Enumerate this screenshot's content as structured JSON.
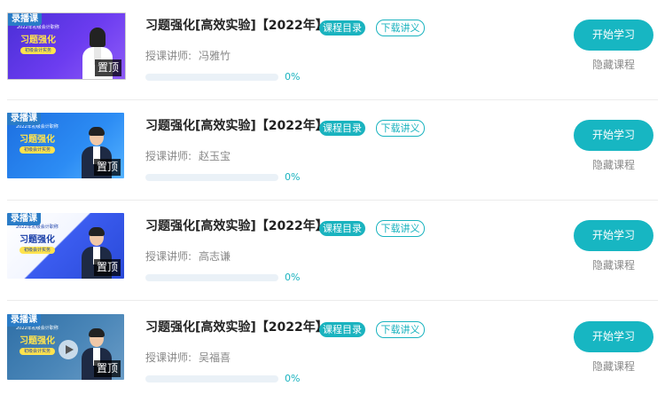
{
  "colors": {
    "accent": "#17b6c2",
    "progress_track": "#eaf1f7",
    "thumb_tag": "#2a7cc7"
  },
  "courses": [
    {
      "title": "习题强化[高效实验]【2022年】",
      "catalog_label": "课程目录",
      "handout_label": "下载讲义",
      "teacher_label": "授课讲师:",
      "teacher_name": "冯雅竹",
      "progress": 0,
      "progress_text": "0%",
      "start_label": "开始学习",
      "hide_label": "隐藏课程",
      "thumb_tag": "录播课",
      "thumb_line1": "2022年初级会计职称",
      "thumb_line2": "习题强化",
      "thumb_line3": "初级会计实务",
      "pin_label": "置顶",
      "thumb_theme": "purple",
      "has_play": false
    },
    {
      "title": "习题强化[高效实验]【2022年】",
      "catalog_label": "课程目录",
      "handout_label": "下载讲义",
      "teacher_label": "授课讲师:",
      "teacher_name": "赵玉宝",
      "progress": 0,
      "progress_text": "0%",
      "start_label": "开始学习",
      "hide_label": "隐藏课程",
      "thumb_tag": "录播课",
      "thumb_line1": "2022年初级会计职称",
      "thumb_line2": "习题强化",
      "thumb_line3": "初级会计实务",
      "pin_label": "置顶",
      "thumb_theme": "blue",
      "has_play": false
    },
    {
      "title": "习题强化[高效实验]【2022年】",
      "catalog_label": "课程目录",
      "handout_label": "下载讲义",
      "teacher_label": "授课讲师:",
      "teacher_name": "高志谦",
      "progress": 0,
      "progress_text": "0%",
      "start_label": "开始学习",
      "hide_label": "隐藏课程",
      "thumb_tag": "录播课",
      "thumb_line1": "2022年初级会计职称",
      "thumb_line2": "习题强化",
      "thumb_line3": "初级会计实务",
      "pin_label": "置顶",
      "thumb_theme": "light",
      "has_play": false
    },
    {
      "title": "习题强化[高效实验]【2022年】",
      "catalog_label": "课程目录",
      "handout_label": "下载讲义",
      "teacher_label": "授课讲师:",
      "teacher_name": "吴福喜",
      "progress": 0,
      "progress_text": "0%",
      "start_label": "开始学习",
      "hide_label": "隐藏课程",
      "thumb_tag": "录播课",
      "thumb_line1": "2022年初级会计职称",
      "thumb_line2": "习题强化",
      "thumb_line3": "初级会计实务",
      "pin_label": "置顶",
      "thumb_theme": "dark",
      "has_play": true
    }
  ]
}
